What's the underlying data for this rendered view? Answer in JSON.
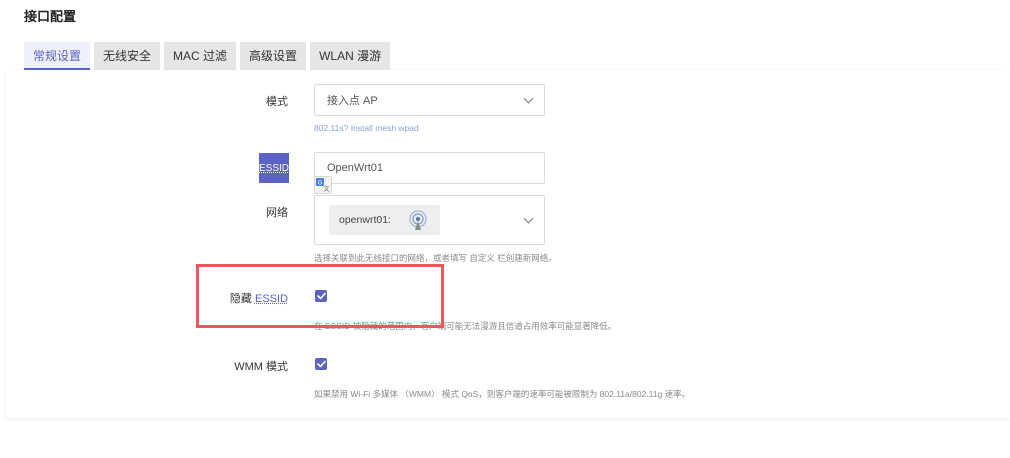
{
  "page": {
    "title": "接口配置"
  },
  "tabs": [
    {
      "label": "常规设置",
      "active": true
    },
    {
      "label": "无线安全",
      "active": false
    },
    {
      "label": "MAC 过滤",
      "active": false
    },
    {
      "label": "高级设置",
      "active": false
    },
    {
      "label": "WLAN 漫游",
      "active": false
    }
  ],
  "form": {
    "mode": {
      "label": "模式",
      "value": "接入点 AP",
      "hint": "802.11s? Install mesh wpad"
    },
    "essid": {
      "label": "ESSID",
      "value": "OpenWrt01"
    },
    "network": {
      "label": "网络",
      "chip": "openwrt01:",
      "hint": "选择关联到此无线接口的网络，或者填写 自定义 栏创建新网络。"
    },
    "hidden_essid": {
      "label_prefix": "隐藏",
      "label_link": "ESSID",
      "checked": true,
      "hint": "在 ESSID 被隐藏的范围内，客户端可能无法漫游且信道占用效率可能显著降低。"
    },
    "wmm": {
      "label": "WMM 模式",
      "checked": true,
      "hint": "如果禁用 Wi-Fi 多媒体 （WMM） 模式 QoS，则客户端的速率可能被限制为 802.11a/802.11g 速率。"
    }
  },
  "colors": {
    "accent": "#5b63c7",
    "highlight_border": "#e8585a"
  },
  "icons": {
    "translate": "translate-icon",
    "wifi": "wifi-antenna-icon",
    "chevron": "chevron-down-icon",
    "check": "check-icon"
  }
}
